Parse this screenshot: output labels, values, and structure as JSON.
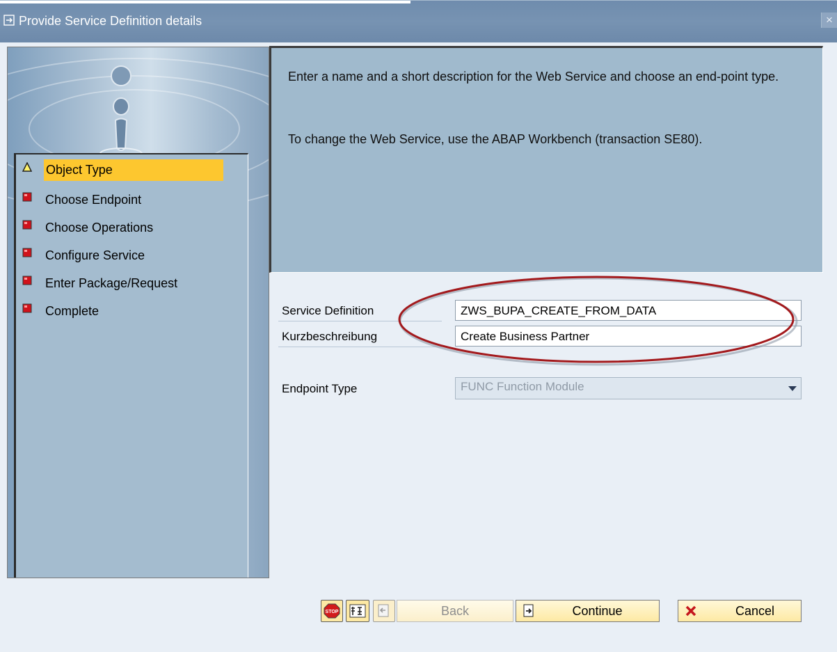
{
  "window": {
    "title": "Provide Service Definition details",
    "close_glyph": "×"
  },
  "steps": [
    {
      "label": "Object Type",
      "state": "current",
      "icon": "warning-triangle-icon"
    },
    {
      "label": "Choose Endpoint",
      "state": "pending",
      "icon": "red-square-icon"
    },
    {
      "label": "Choose Operations",
      "state": "pending",
      "icon": "red-square-icon"
    },
    {
      "label": "Configure Service",
      "state": "pending",
      "icon": "red-square-icon"
    },
    {
      "label": "Enter Package/Request",
      "state": "pending",
      "icon": "red-square-icon"
    },
    {
      "label": "Complete",
      "state": "pending",
      "icon": "red-square-icon"
    }
  ],
  "info": {
    "paragraph1": "Enter a name and a short description for the Web Service and choose an end-point type.",
    "paragraph2": "To change the Web Service, use the ABAP Workbench (transaction SE80)."
  },
  "form": {
    "service_definition": {
      "label": "Service Definition",
      "value": "ZWS_BUPA_CREATE_FROM_DATA"
    },
    "short_description": {
      "label": "Kurzbeschreibung",
      "value": "Create Business Partner"
    },
    "endpoint_type": {
      "label": "Endpoint Type",
      "value": "FUNC Function Module",
      "disabled": true
    }
  },
  "buttons": {
    "back": "Back",
    "continue": "Continue",
    "cancel": "Cancel"
  },
  "colors": {
    "title_bar": "#7391b1",
    "active_step": "#fdc72f",
    "info_panel": "#a0bacd",
    "annotation_ellipse": "#a3191c",
    "button_face": "#fde9a4"
  }
}
